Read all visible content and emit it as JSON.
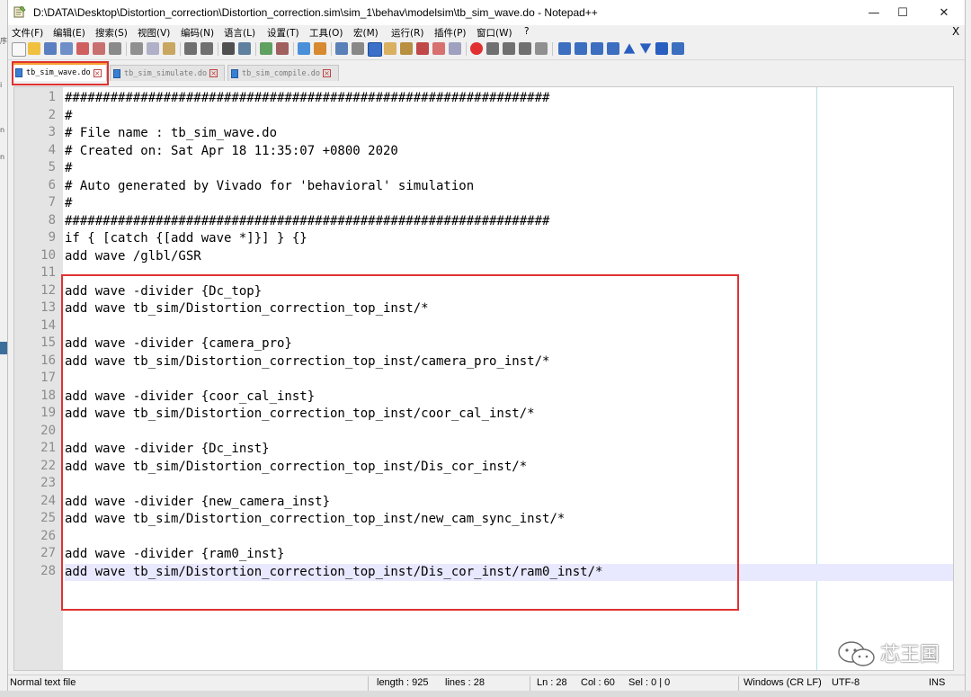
{
  "window": {
    "title": "D:\\DATA\\Desktop\\Distortion_correction\\Distortion_correction.sim\\sim_1\\behav\\modelsim\\tb_sim_wave.do - Notepad++",
    "app_icon": "notepad-plus-plus-icon",
    "controls": {
      "minimize": "—",
      "maximize": "☐",
      "close": "✕"
    }
  },
  "menubar": {
    "items": [
      {
        "label": "文件(F)"
      },
      {
        "label": "编辑(E)"
      },
      {
        "label": "搜索(S)"
      },
      {
        "label": "视图(V)"
      },
      {
        "label": "编码(N)"
      },
      {
        "label": "语言(L)"
      },
      {
        "label": "设置(T)"
      },
      {
        "label": "工具(O)"
      },
      {
        "label": "宏(M)"
      },
      {
        "label": "运行(R)"
      },
      {
        "label": "插件(P)"
      },
      {
        "label": "窗口(W)"
      },
      {
        "label": "?"
      }
    ],
    "close_doc": "X"
  },
  "tabs": [
    {
      "label": "tb_sim_wave.do",
      "active": true
    },
    {
      "label": "tb_sim_simulate.do",
      "active": false
    },
    {
      "label": "tb_sim_compile.do",
      "active": false
    }
  ],
  "editor": {
    "current_line": 28,
    "lines": [
      "################################################################",
      "#",
      "# File name : tb_sim_wave.do",
      "# Created on: Sat Apr 18 11:35:07 +0800 2020",
      "#",
      "# Auto generated by Vivado for 'behavioral' simulation",
      "#",
      "################################################################",
      "if { [catch {[add wave *]}] } {}",
      "add wave /glbl/GSR",
      "",
      "add wave -divider {Dc_top}",
      "add wave tb_sim/Distortion_correction_top_inst/*",
      "",
      "add wave -divider {camera_pro}",
      "add wave tb_sim/Distortion_correction_top_inst/camera_pro_inst/*",
      "",
      "add wave -divider {coor_cal_inst}",
      "add wave tb_sim/Distortion_correction_top_inst/coor_cal_inst/*",
      "",
      "add wave -divider {Dc_inst}",
      "add wave tb_sim/Distortion_correction_top_inst/Dis_cor_inst/*",
      "",
      "add wave -divider {new_camera_inst}",
      "add wave tb_sim/Distortion_correction_top_inst/new_cam_sync_inst/*",
      "",
      "add wave -divider {ram0_inst}",
      "add wave tb_sim/Distortion_correction_top_inst/Dis_cor_inst/ram0_inst/*"
    ]
  },
  "statusbar": {
    "file_type": "Normal text file",
    "length": "length : 925",
    "lines": "lines : 28",
    "ln": "Ln : 28",
    "col": "Col : 60",
    "sel": "Sel : 0 | 0",
    "eol": "Windows (CR LF)",
    "encoding": "UTF-8",
    "mode": "INS"
  },
  "watermark": {
    "text": "芯王国",
    "icon": "wechat-icon"
  },
  "colors": {
    "highlight_box": "#e03232",
    "current_line_bg": "#e8e8ff",
    "gutter_bg": "#e4e4e4",
    "active_tab_accent": "#f5a030"
  }
}
